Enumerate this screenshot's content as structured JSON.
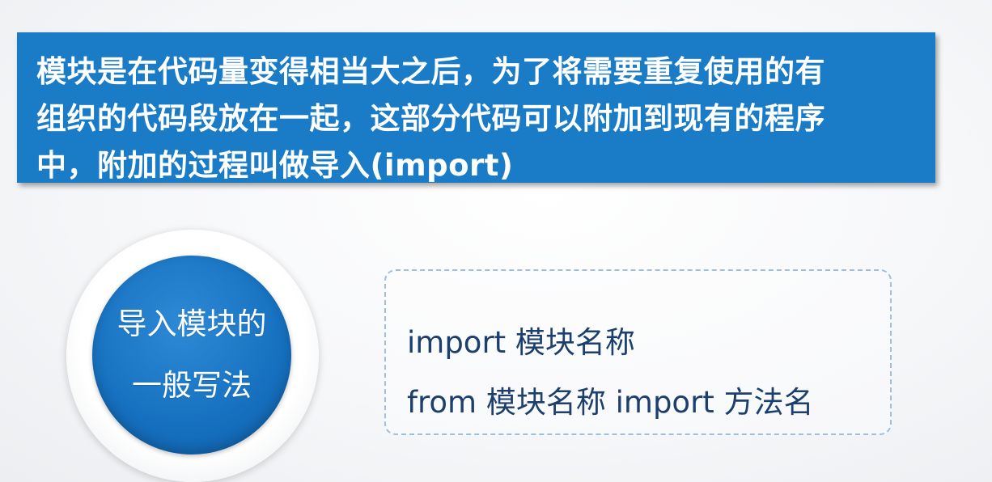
{
  "banner": {
    "line1": "模块是在代码量变得相当大之后，为了将需要重复使用的有",
    "line2": "组织的代码段放在一起，这部分代码可以附加到现有的程序",
    "line3": "中，附加的过程叫做导入(import)"
  },
  "circle": {
    "line1": "导入模块的",
    "line2": "一般写法"
  },
  "syntax": {
    "line1": "import 模块名称",
    "line2": "from 模块名称 import 方法名"
  },
  "colors": {
    "banner_bg": "#1a7bc7",
    "circle_fill": "#1670bf",
    "code_text": "#1c3f6e"
  }
}
